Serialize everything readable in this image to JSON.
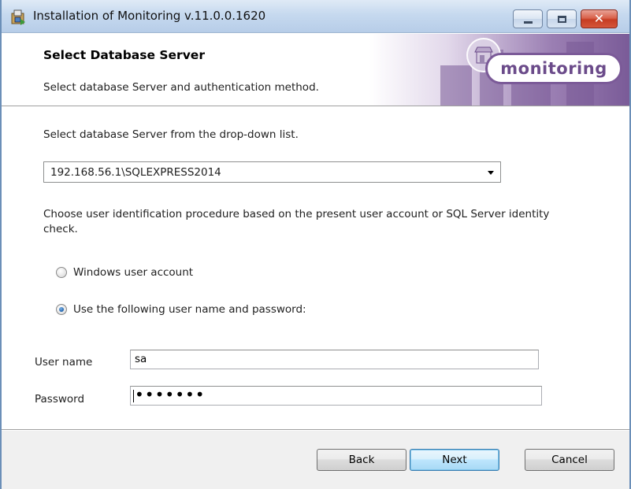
{
  "window": {
    "title": "Installation of Monitoring v.11.0.0.1620",
    "controls": {
      "minimize": "minimize",
      "maximize": "maximize",
      "close": "✕"
    }
  },
  "banner": {
    "title": "Select Database Server",
    "subtitle": "Select database Server and authentication method.",
    "logo_text": "monitoring"
  },
  "main": {
    "instruction": "Select database Server from the drop-down list.",
    "server_select": {
      "value": "192.168.56.1\\SQLEXPRESS2014"
    },
    "auth_description": "Choose user identification procedure based on the present user account or SQL Server identity check.",
    "auth_options": [
      {
        "label": "Windows user account",
        "checked": false
      },
      {
        "label": "Use the following user name and password:",
        "checked": true
      }
    ],
    "username": {
      "label": "User name",
      "value": "sa"
    },
    "password": {
      "label": "Password",
      "value": "•••••••"
    }
  },
  "footer": {
    "back_label": "Back",
    "next_label": "Next",
    "cancel_label": "Cancel"
  },
  "colors": {
    "title_bar": "#c6d9ef",
    "close_button": "#c63d23",
    "logo_purple": "#6b4b8a",
    "default_button": "#bee6fd"
  }
}
